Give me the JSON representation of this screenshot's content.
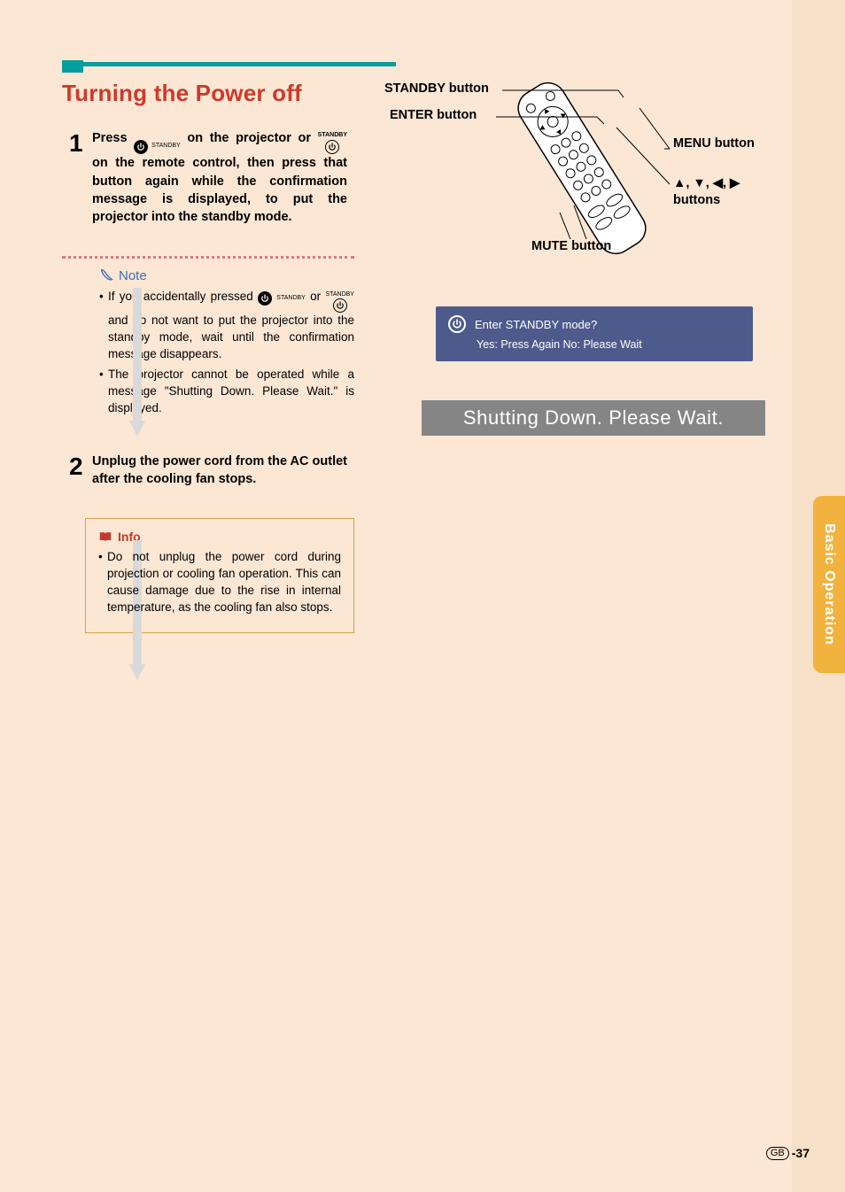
{
  "section_title": "Turning the Power off",
  "steps": [
    {
      "num": "1",
      "text_parts": {
        "a": "Press ",
        "b": " on the projector or ",
        "c": " on the remote control, then press that button again while the confirmation message is displayed, to put the projector into the standby mode."
      },
      "icon_label": "STANDBY"
    },
    {
      "num": "2",
      "text": "Unplug the power cord from the AC outlet after the cooling fan stops."
    }
  ],
  "note": {
    "label": "Note",
    "items": [
      {
        "a": "If you accidentally pressed ",
        "b": " or ",
        "c": " and do not want to put the projector into the standby mode, wait until the confirmation message disappears."
      },
      "The projector cannot be operated while a message \"Shutting Down. Please Wait.\" is displayed."
    ]
  },
  "info": {
    "label": "Info",
    "items": [
      "Do not unplug the power cord during projection or cooling fan operation. This can cause damage due to the rise in internal temperature, as the cooling fan also stops."
    ]
  },
  "diagram": {
    "standby_button": "STANDBY button",
    "enter_button": "ENTER button",
    "menu_button": "MENU button",
    "arrow_buttons_sym": "▲, ▼, ◀, ▶",
    "arrow_buttons_label": "buttons",
    "mute_button": "MUTE button"
  },
  "dialog": {
    "line1": "Enter STANDBY mode?",
    "line2": "Yes: Press Again   No: Please Wait"
  },
  "shutting": "Shutting Down. Please Wait.",
  "side_tab": "Basic Operation",
  "page": {
    "region": "GB",
    "num": "-37"
  }
}
